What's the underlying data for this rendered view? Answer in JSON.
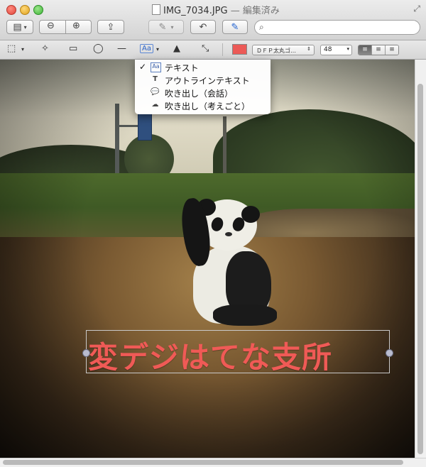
{
  "window": {
    "filename": "IMG_7034.JPG",
    "separator": " — ",
    "status": "編集済み"
  },
  "toolbar": {
    "sidebar_icon": "sidebar-icon",
    "zoom_out_icon": "zoom-out-icon",
    "zoom_in_icon": "zoom-in-icon",
    "share_icon": "share-icon",
    "highlight_icon": "highlight-icon",
    "rotate_icon": "rotate-icon",
    "markup_icon": "markup-pen-icon",
    "search_placeholder": ""
  },
  "markup": {
    "font_name": "ＤＦＰ太丸ゴ…",
    "font_size": "48",
    "align_left": "≡",
    "align_center": "≡",
    "align_right": "≡",
    "text_color": "#ec5a57"
  },
  "menu": {
    "items": [
      {
        "label": "テキスト",
        "checked": true,
        "icon": "text-box-icon"
      },
      {
        "label": "アウトラインテキスト",
        "checked": false,
        "icon": "outline-text-icon"
      },
      {
        "label": "吹き出し（会話）",
        "checked": false,
        "icon": "speech-bubble-icon"
      },
      {
        "label": "吹き出し（考えごと）",
        "checked": false,
        "icon": "thought-bubble-icon"
      }
    ]
  },
  "annotation": {
    "text": "変デジはてな支所",
    "color": "#f05a56"
  }
}
